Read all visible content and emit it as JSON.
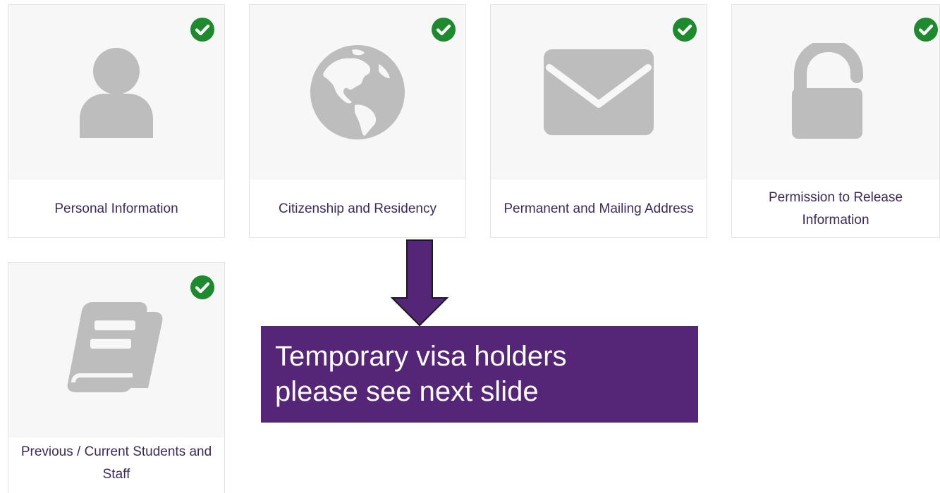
{
  "tiles": [
    {
      "label": "Personal Information",
      "icon": "user-icon",
      "completed": true
    },
    {
      "label": "Citizenship and Residency",
      "icon": "globe-icon",
      "completed": true
    },
    {
      "label": "Permanent and Mailing Address",
      "icon": "envelope-icon",
      "completed": true
    },
    {
      "label": "Permission to Release Information",
      "icon": "unlock-icon",
      "completed": true
    },
    {
      "label": "Previous / Current Students and Staff",
      "icon": "book-icon",
      "completed": true
    }
  ],
  "notice": {
    "line1": "Temporary visa holders",
    "line2": "please see next slide"
  },
  "colors": {
    "icon_gray": "#bdbdbd",
    "tile_bg": "#f7f7f7",
    "check_green": "#1e8a2e",
    "label_text": "#3c2a5a",
    "callout_purple": "#552577"
  }
}
